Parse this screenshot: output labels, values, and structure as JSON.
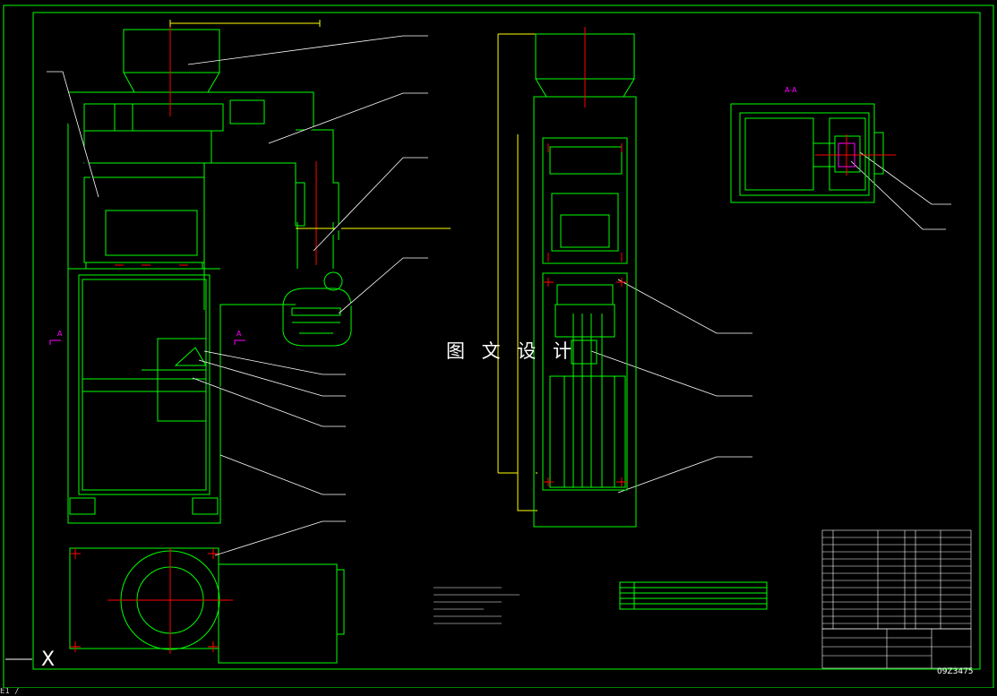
{
  "watermark": "图 文 设 计",
  "drawing_number": "09Z3475",
  "cursor_label": "X",
  "status_text": "E1 /",
  "section_marks": {
    "left": "A",
    "right": "A",
    "view": "A-A"
  },
  "colors": {
    "background": "#000000",
    "frame": "#00ff00",
    "outline": "#00ff00",
    "center": "#ff0000",
    "dim": "#ffff00",
    "leader": "#ffffff",
    "accent": "#ff00ff"
  }
}
